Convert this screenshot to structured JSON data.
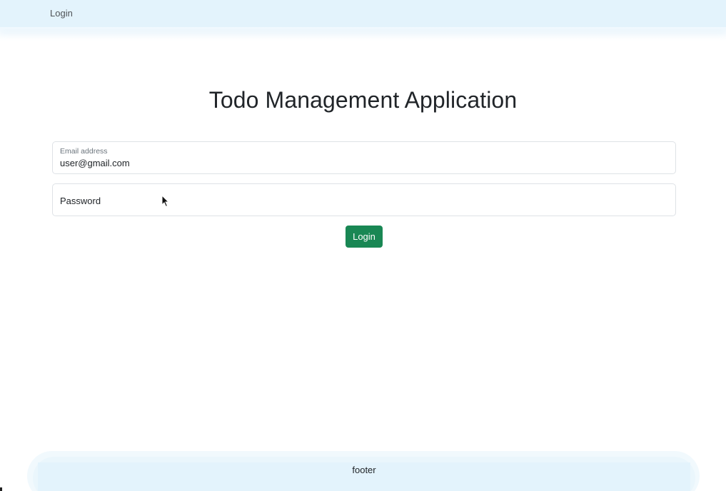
{
  "navbar": {
    "login_link": "Login"
  },
  "main": {
    "title": "Todo Management Application"
  },
  "form": {
    "email": {
      "label": "Email address",
      "value": "user@gmail.com"
    },
    "password": {
      "placeholder": "Password",
      "value": ""
    },
    "submit_label": "Login"
  },
  "footer": {
    "text": "footer"
  },
  "colors": {
    "navbar_bg": "#e3f3fc",
    "primary_button": "#198754",
    "border": "#dee2e6"
  },
  "icons": {
    "cursor": "mouse-pointer-icon"
  }
}
